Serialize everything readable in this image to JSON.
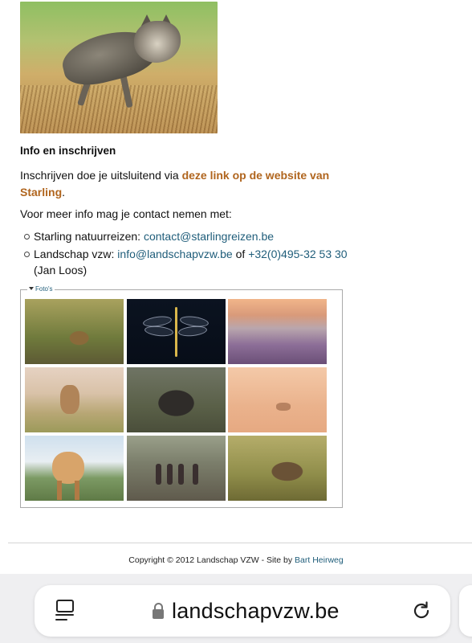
{
  "hero": {
    "alt": "wolf photo"
  },
  "info": {
    "title": "Info en inschrijven",
    "para1_prefix": "Inschrijven doe je uitsluitend via ",
    "para1_link": "deze link op de website van Starling",
    "para1_suffix": ".",
    "para2": "Voor meer info mag je contact nemen met:",
    "contacts": [
      {
        "label": "Starling natuurreizen: ",
        "link": "contact@starlingreizen.be"
      },
      {
        "label": "Landschap vzw: ",
        "link": "info@landschapvzw.be",
        "mid": " of ",
        "phone": "+32(0)495-32 53 30",
        "extra": "(Jan Loos)"
      }
    ]
  },
  "gallery": {
    "legend": "Foto's",
    "photos": [
      "marten",
      "dragonfly",
      "heathland",
      "roe-deer",
      "wild-boar",
      "deer-in-mist",
      "horse",
      "hikers",
      "piglet"
    ]
  },
  "footer": {
    "copyright": "Copyright © 2012 Landschap VZW - Site by ",
    "author": "Bart Heirweg"
  },
  "browser": {
    "url": "landschapvzw.be",
    "icons": [
      "tabs-icon",
      "lock-icon",
      "reload-icon"
    ]
  }
}
